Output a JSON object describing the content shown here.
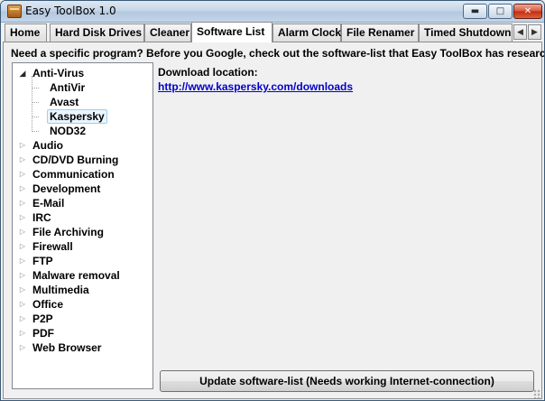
{
  "window": {
    "title": "Easy ToolBox 1.0",
    "min_glyph": "▬",
    "max_glyph": "□",
    "close_glyph": "✕"
  },
  "tabs": [
    {
      "label": "Home"
    },
    {
      "label": "Hard Disk Drives"
    },
    {
      "label": "Cleaner"
    },
    {
      "label": "Software List",
      "active": true
    },
    {
      "label": "Alarm Clock"
    },
    {
      "label": "File Renamer"
    },
    {
      "label": "Timed Shutdown"
    }
  ],
  "tab_scroll": {
    "left": "◀",
    "right": "▶"
  },
  "description": "Need a specific program? Before you Google, check out the software-list that Easy ToolBox has researche",
  "tree": {
    "expanded": {
      "label": "Anti-Virus",
      "children": [
        "AntiVir",
        "Avast",
        "Kaspersky",
        "NOD32"
      ],
      "selected": "Kaspersky"
    },
    "collapsed": [
      "Audio",
      "CD/DVD Burning",
      "Communication",
      "Development",
      "E-Mail",
      "IRC",
      "File Archiving",
      "Firewall",
      "FTP",
      "Malware removal",
      "Multimedia",
      "Office",
      "P2P",
      "PDF",
      "Web Browser"
    ],
    "expander_open": "◢",
    "expander_closed": "▷"
  },
  "download": {
    "label": "Download location:",
    "url": "http://www.kaspersky.com/downloads"
  },
  "update_button": "Update software-list (Needs working Internet-connection)"
}
